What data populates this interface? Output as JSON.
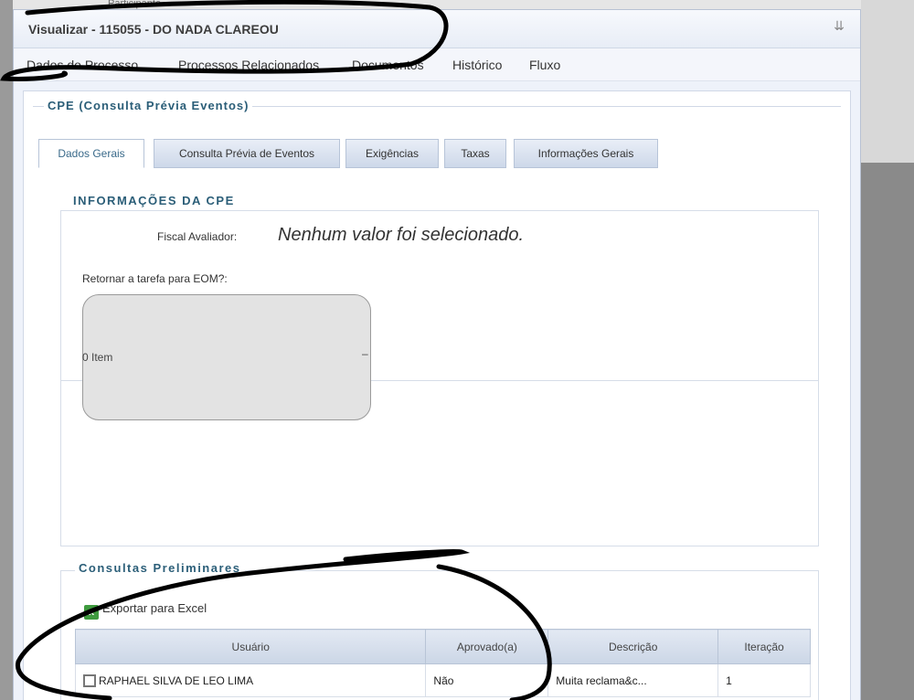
{
  "window": {
    "title": "Visualizar - 115055 - DO NADA CLAREOU",
    "background_peek": "Participante"
  },
  "nav": {
    "items": [
      "Dados do Processo",
      "Processos Relacionados",
      "Documentos",
      "Histórico",
      "Fluxo"
    ]
  },
  "cpe_section": {
    "legend": "CPE (Consulta Prévia Eventos)",
    "tabs": [
      "Dados Gerais",
      "Consulta Prévia de Eventos",
      "Exigências",
      "Taxas",
      "Informações Gerais"
    ],
    "active_tab": "Dados Gerais"
  },
  "info": {
    "legend": "INFORMAÇÕES DA CPE",
    "fiscal_label": "Fiscal Avaliador:",
    "fiscal_value": "Nenhum valor foi selecionado.",
    "retornar_label": "Retornar a tarefa para EOM?:",
    "item_count": "0 Item"
  },
  "consultas": {
    "legend": "Consultas Preliminares",
    "export_label": "Exportar para Excel",
    "columns": [
      "Usuário",
      "Aprovado(a)",
      "Descrição",
      "Iteração"
    ],
    "rows": [
      {
        "usuario": "RAPHAEL SILVA DE LEO LIMA",
        "aprovado": "Não",
        "descricao": "Muita reclama&c...",
        "iteracao": "1"
      }
    ]
  },
  "colors": {
    "legend": "#2b5e78",
    "modal_bg": "#eef2fa",
    "annotation": "#000000"
  }
}
